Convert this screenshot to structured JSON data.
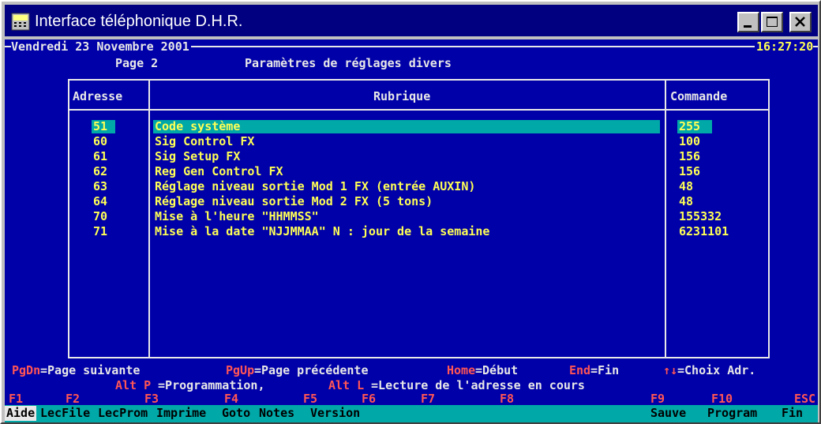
{
  "window": {
    "title": "Interface téléphonique D.H.R."
  },
  "header": {
    "date": "Vendredi 23 Novembre 2001",
    "time": "16:27:20",
    "page": "Page 2",
    "heading": "Paramètres de réglages divers"
  },
  "table": {
    "headers": {
      "address": "Adresse",
      "item": "Rubrique",
      "command": "Commande"
    },
    "rows": [
      {
        "address": "51",
        "item": "Code système",
        "command": "255"
      },
      {
        "address": "60",
        "item": "Sig Control FX",
        "command": "100"
      },
      {
        "address": "61",
        "item": "Sig Setup FX",
        "command": "156"
      },
      {
        "address": "62",
        "item": "Reg Gen Control FX",
        "command": "156"
      },
      {
        "address": "63",
        "item": "Réglage niveau sortie Mod 1 FX (entrée AUXIN)",
        "command": "48"
      },
      {
        "address": "64",
        "item": "Réglage niveau sortie Mod 2 FX (5 tons)",
        "command": "48"
      },
      {
        "address": "70",
        "item": "Mise à l'heure \"HHMMSS\"",
        "command": "155332"
      },
      {
        "address": "71",
        "item": "Mise à la date \"NJJMMAA\" N : jour de la semaine",
        "command": "6231101"
      }
    ],
    "selected_row": 0
  },
  "help": {
    "pgdn_key": "PgDn",
    "pgdn_text": "=Page suivante",
    "pgup_key": "PgUp",
    "pgup_text": "=Page précédente",
    "home_key": "Home",
    "home_text": "=Début",
    "end_key": "End",
    "end_text": "=Fin",
    "arrows_key": "↑↓",
    "arrows_text": "=Choix Adr.",
    "altp_key": "Alt P",
    "altp_text": " =Programmation,",
    "altl_key": "Alt L",
    "altl_text": " =Lecture de l'adresse en cours"
  },
  "function_keys": [
    {
      "key": "F1",
      "label": "Aide"
    },
    {
      "key": "F2",
      "label": "LecFile"
    },
    {
      "key": "F3",
      "label": "LecProm"
    },
    {
      "key": "F4",
      "label": "Imprime"
    },
    {
      "key": "F5",
      "label": "Goto"
    },
    {
      "key": "F6",
      "label": "Notes"
    },
    {
      "key": "F7",
      "label": "Version"
    },
    {
      "key": "F8",
      "label": ""
    },
    {
      "key": "F9",
      "label": "Sauve"
    },
    {
      "key": "F10",
      "label": "Program"
    },
    {
      "key": "ESC",
      "label": "Fin"
    }
  ],
  "colors": {
    "console_bg": "#0000a8",
    "highlight": "#00a8a8",
    "text": "#e8e8e8",
    "value": "#ffff55",
    "key": "#ff5555"
  }
}
